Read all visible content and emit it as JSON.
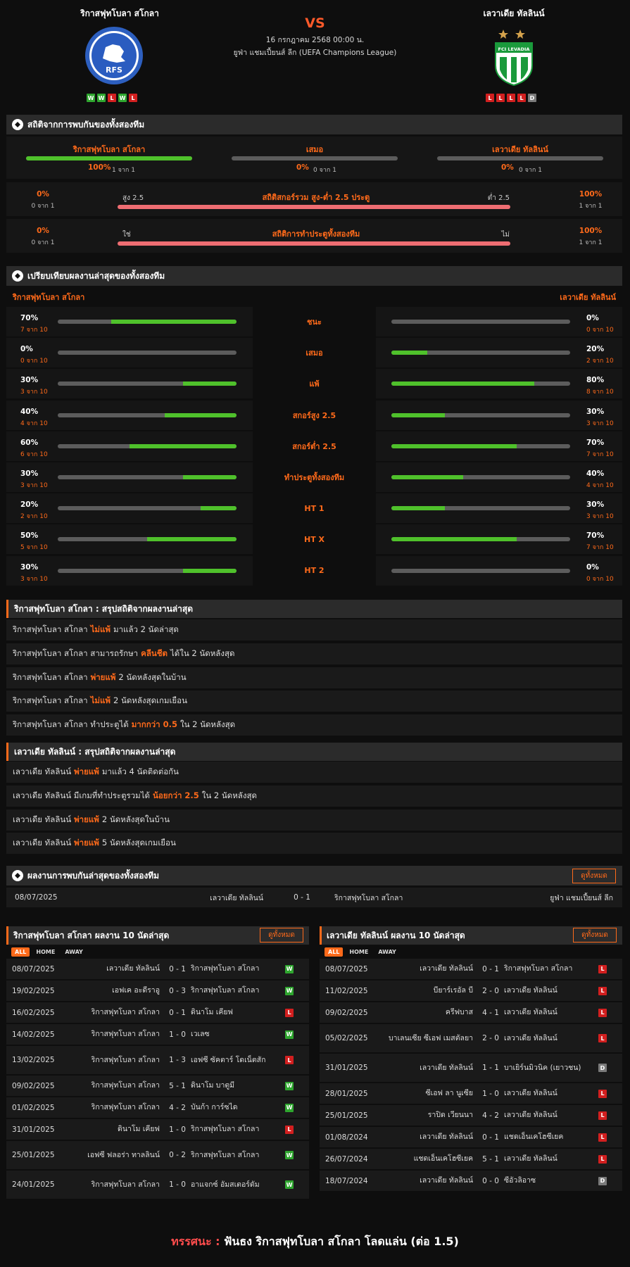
{
  "header": {
    "home": "ริกาสฟุทโบลา สโกลา",
    "away": "เลวาเดีย ทัลลินน์",
    "vs": "VS",
    "date": "16 กรกฎาคม 2568 00:00 น.",
    "league": "ยูฟ่า แชมเปี้ยนส์ ลีก (UEFA Champions League)",
    "home_form": [
      "W",
      "W",
      "L",
      "W",
      "L"
    ],
    "away_form": [
      "L",
      "L",
      "L",
      "L",
      "D"
    ],
    "home_logo_text": "RFS",
    "away_logo_text": "FCI LEVADIA"
  },
  "h2h": {
    "title": "สถิติจากการพบกันของทั้งสองทีม",
    "home_label": "ริกาสฟุทโบลา สโกลา",
    "draw_label": "เสมอ",
    "away_label": "เลวาเดีย ทัลลินน์",
    "home_pct": "100%",
    "home_cnt": "1 จาก 1",
    "draw_pct": "0%",
    "draw_cnt": "0 จาก 1",
    "away_pct": "0%",
    "away_cnt": "0 จาก 1",
    "home_fill": 1,
    "draw_fill": 0,
    "away_fill": 0
  },
  "ou": {
    "title": "สถิติสกอร์รวม สูง-ต่ำ 2.5 ประตู",
    "left_label": "สูง 2.5",
    "right_label": "ต่ำ 2.5",
    "left_pct": "0%",
    "left_cnt": "0 จาก 1",
    "right_pct": "100%",
    "right_cnt": "1 จาก 1"
  },
  "btts": {
    "title": "สถิติการทำประตูทั้งสองทีม",
    "left_label": "ใช่",
    "right_label": "ไม่",
    "left_pct": "0%",
    "left_cnt": "0 จาก 1",
    "right_pct": "100%",
    "right_cnt": "1 จาก 1"
  },
  "compare": {
    "title": "เปรียบเทียบผลงานล่าสุดของทั้งสองทีม",
    "home": "ริกาสฟุทโบลา สโกลา",
    "away": "เลวาเดีย ทัลลินน์",
    "rows": [
      {
        "label": "ชนะ",
        "hp": "70%",
        "hc": "7 จาก 10",
        "hf": 0.7,
        "ap": "0%",
        "ac": "0 จาก 10",
        "af": 0
      },
      {
        "label": "เสมอ",
        "hp": "0%",
        "hc": "0 จาก 10",
        "hf": 0,
        "ap": "20%",
        "ac": "2 จาก 10",
        "af": 0.2
      },
      {
        "label": "แพ้",
        "hp": "30%",
        "hc": "3 จาก 10",
        "hf": 0.3,
        "ap": "80%",
        "ac": "8 จาก 10",
        "af": 0.8
      },
      {
        "label": "สกอร์สูง 2.5",
        "hp": "40%",
        "hc": "4 จาก 10",
        "hf": 0.4,
        "ap": "30%",
        "ac": "3 จาก 10",
        "af": 0.3
      },
      {
        "label": "สกอร์ต่ำ 2.5",
        "hp": "60%",
        "hc": "6 จาก 10",
        "hf": 0.6,
        "ap": "70%",
        "ac": "7 จาก 10",
        "af": 0.7
      },
      {
        "label": "ทำประตูทั้งสองทีม",
        "hp": "30%",
        "hc": "3 จาก 10",
        "hf": 0.3,
        "ap": "40%",
        "ac": "4 จาก 10",
        "af": 0.4
      },
      {
        "label": "HT 1",
        "hp": "20%",
        "hc": "2 จาก 10",
        "hf": 0.2,
        "ap": "30%",
        "ac": "3 จาก 10",
        "af": 0.3
      },
      {
        "label": "HT X",
        "hp": "50%",
        "hc": "5 จาก 10",
        "hf": 0.5,
        "ap": "70%",
        "ac": "7 จาก 10",
        "af": 0.7
      },
      {
        "label": "HT 2",
        "hp": "30%",
        "hc": "3 จาก 10",
        "hf": 0.3,
        "ap": "0%",
        "ac": "0 จาก 10",
        "af": 0
      }
    ]
  },
  "home_summary": {
    "title": "ริกาสฟุทโบลา สโกลา : สรุปสถิติจากผลงานล่าสุด",
    "rows": [
      [
        "ริกาสฟุทโบลา สโกลา",
        "ไม่แพ้",
        "มาแล้ว 2 นัดล่าสุด"
      ],
      [
        "ริกาสฟุทโบลา สโกลา สามารถรักษา",
        "คลีนชีต",
        "ได้ใน 2 นัดหลังสุด"
      ],
      [
        "ริกาสฟุทโบลา สโกลา",
        "พ่ายแพ้",
        "2 นัดหลังสุดในบ้าน"
      ],
      [
        "ริกาสฟุทโบลา สโกลา",
        "ไม่แพ้",
        "2 นัดหลังสุดเกมเยือน"
      ],
      [
        "ริกาสฟุทโบลา สโกลา ทำประตูได้",
        "มากกว่า 0.5",
        "ใน 2 นัดหลังสุด"
      ]
    ]
  },
  "away_summary": {
    "title": "เลวาเดีย ทัลลินน์ : สรุปสถิติจากผลงานล่าสุด",
    "rows": [
      [
        "เลวาเดีย ทัลลินน์",
        "พ่ายแพ้",
        "มาแล้ว 4 นัดติดต่อกัน"
      ],
      [
        "เลวาเดีย ทัลลินน์ มีเกมที่ทำประตูรวมได้",
        "น้อยกว่า 2.5",
        "ใน 2 นัดหลังสุด"
      ],
      [
        "เลวาเดีย ทัลลินน์",
        "พ่ายแพ้",
        "2 นัดหลังสุดในบ้าน"
      ],
      [
        "เลวาเดีย ทัลลินน์",
        "พ่ายแพ้",
        "5 นัดหลังสุดเกมเยือน"
      ]
    ]
  },
  "h2h_results": {
    "title": "ผลงานการพบกันล่าสุดของทั้งสองทีม",
    "view_all": "ดูทั้งหมด",
    "rows": [
      {
        "date": "08/07/2025",
        "home": "เลวาเดีย ทัลลินน์",
        "score": "0 - 1",
        "away": "ริกาสฟุทโบลา สโกลา",
        "league": "ยูฟ่า แชมเปี้ยนส์ ลีก"
      }
    ]
  },
  "home_last10": {
    "title": "ริกาสฟุทโบลา สโกลา ผลงาน 10 นัดล่าสุด",
    "view_all": "ดูทั้งหมด",
    "tabs": [
      "ALL",
      "HOME",
      "AWAY"
    ],
    "rows": [
      {
        "date": "08/07/2025",
        "home": "เลวาเดีย ทัลลินน์",
        "score": "0 - 1",
        "away": "ริกาสฟุทโบลา สโกลา",
        "res": "W"
      },
      {
        "date": "19/02/2025",
        "home": "เอฟเค อะดีราอู",
        "score": "0 - 3",
        "away": "ริกาสฟุทโบลา สโกลา",
        "res": "W"
      },
      {
        "date": "16/02/2025",
        "home": "ริกาสฟุทโบลา สโกลา",
        "score": "0 - 1",
        "away": "ดินาโม เคียฟ",
        "res": "L"
      },
      {
        "date": "14/02/2025",
        "home": "ริกาสฟุทโบลา สโกลา",
        "score": "1 - 0",
        "away": "เวเลซ",
        "res": "W"
      },
      {
        "date": "13/02/2025",
        "home": "ริกาสฟุทโบลา สโกลา",
        "score": "1 - 3",
        "away": "เอฟซี ซัคตาร์ โดเน็ตสัก",
        "res": "L"
      },
      {
        "date": "09/02/2025",
        "home": "ริกาสฟุทโบลา สโกลา",
        "score": "5 - 1",
        "away": "ดินาโม บาตูมี",
        "res": "W"
      },
      {
        "date": "01/02/2025",
        "home": "ริกาสฟุทโบลา สโกลา",
        "score": "4 - 2",
        "away": "บันก้า การ์ซได",
        "res": "W"
      },
      {
        "date": "31/01/2025",
        "home": "ดินาโม เคียฟ",
        "score": "1 - 0",
        "away": "ริกาสฟุทโบลา สโกลา",
        "res": "L"
      },
      {
        "date": "25/01/2025",
        "home": "เอฟซี ฟลอร่า ทาลลินน์",
        "score": "0 - 2",
        "away": "ริกาสฟุทโบลา สโกลา",
        "res": "W"
      },
      {
        "date": "24/01/2025",
        "home": "ริกาสฟุทโบลา สโกลา",
        "score": "1 - 0",
        "away": "อาแจกซ์ อัมสเตอร์ดัม",
        "res": "W"
      }
    ]
  },
  "away_last10": {
    "title": "เลวาเดีย ทัลลินน์ ผลงาน 10 นัดล่าสุด",
    "view_all": "ดูทั้งหมด",
    "tabs": [
      "ALL",
      "HOME",
      "AWAY"
    ],
    "rows": [
      {
        "date": "08/07/2025",
        "home": "เลวาเดีย ทัลลินน์",
        "score": "0 - 1",
        "away": "ริกาสฟุทโบลา สโกลา",
        "res": "L"
      },
      {
        "date": "11/02/2025",
        "home": "บียาร์เรอัล บี",
        "score": "2 - 0",
        "away": "เลวาเดีย ทัลลินน์",
        "res": "L"
      },
      {
        "date": "09/02/2025",
        "home": "ครีฟบาส",
        "score": "4 - 1",
        "away": "เลวาเดีย ทัลลินน์",
        "res": "L"
      },
      {
        "date": "05/02/2025",
        "home": "บาเลนเซีย ซีเอฟ เมสตัลยา",
        "score": "2 - 0",
        "away": "เลวาเดีย ทัลลินน์",
        "res": "L"
      },
      {
        "date": "31/01/2025",
        "home": "เลวาเดีย ทัลลินน์",
        "score": "1 - 1",
        "away": "บาเยิร์นมิวนิค (เยาวชน)",
        "res": "D"
      },
      {
        "date": "28/01/2025",
        "home": "ซีเอฟ ลา นูเซีย",
        "score": "1 - 0",
        "away": "เลวาเดีย ทัลลินน์",
        "res": "L"
      },
      {
        "date": "25/01/2025",
        "home": "ราปิด เวียนนา",
        "score": "4 - 2",
        "away": "เลวาเดีย ทัลลินน์",
        "res": "L"
      },
      {
        "date": "01/08/2024",
        "home": "เลวาเดีย ทัลลินน์",
        "score": "0 - 1",
        "away": "แชดเอ็นเคโฮซีเยค",
        "res": "L"
      },
      {
        "date": "26/07/2024",
        "home": "แชดเอ็นเคโฮซีเยค",
        "score": "5 - 1",
        "away": "เลวาเดีย ทัลลินน์",
        "res": "L"
      },
      {
        "date": "18/07/2024",
        "home": "เลวาเดีย ทัลลินน์",
        "score": "0 - 0",
        "away": "ซีอัวลิอาซ",
        "res": "D"
      }
    ]
  },
  "footer": {
    "label": "ทรรศนะ :",
    "text": "ฟันธง ริกาสฟุทโบลา สโกลา โลดแล่น (ต่อ 1.5)"
  }
}
